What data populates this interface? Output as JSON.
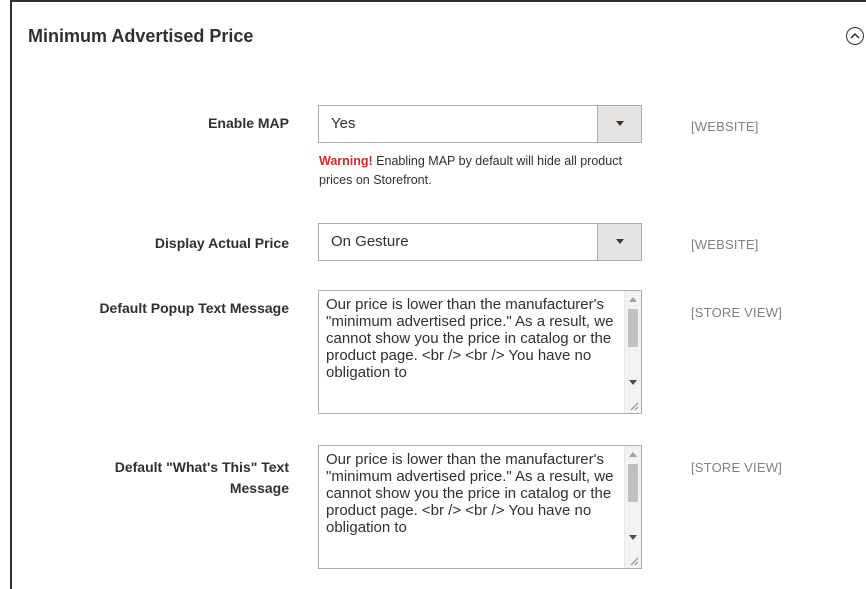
{
  "section": {
    "title": "Minimum Advertised Price",
    "collapse_icon": "chevron-up-circle-icon"
  },
  "rows": {
    "enable_map": {
      "label": "Enable MAP",
      "value": "Yes",
      "scope": "[WEBSITE]",
      "note_warning": "Warning!",
      "note_text": " Enabling MAP by default will hide all product prices on Storefront."
    },
    "display_actual_price": {
      "label": "Display Actual Price",
      "value": "On Gesture",
      "scope": "[WEBSITE]"
    },
    "default_popup_text": {
      "label": "Default Popup Text Message",
      "value": "Our price is lower than the manufacturer's \"minimum advertised price.\" As a result, we cannot show you the price in catalog or the product page. <br /> <br /> You have no obligation to",
      "scope": "[STORE VIEW]"
    },
    "default_whats_this_text": {
      "label": "Default \"What's This\" Text Message",
      "value": "Our price is lower than the manufacturer's \"minimum advertised price.\" As a result, we cannot show you the price in catalog or the product page. <br /> <br /> You have no obligation to",
      "scope": "[STORE VIEW]"
    }
  },
  "colors": {
    "warning": "#e22626",
    "text": "#303030",
    "scope": "#808080",
    "border": "#adadad"
  }
}
